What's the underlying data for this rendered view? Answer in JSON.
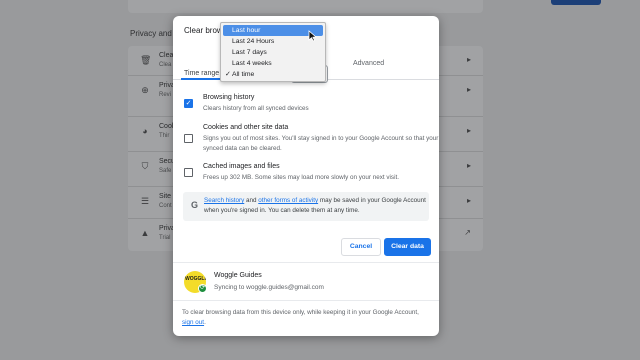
{
  "background": {
    "section_title": "Privacy and s",
    "rows": [
      {
        "icon": "trash-icon",
        "glyph": "🗑",
        "t1": "Clea",
        "t2": "Clea"
      },
      {
        "icon": "privacy-guide-icon",
        "glyph": "⊕",
        "t1": "Priva",
        "t2": "Revi"
      },
      {
        "icon": "cookie-icon",
        "glyph": "◕",
        "t1": "Cook",
        "t2": "Thir"
      },
      {
        "icon": "shield-icon",
        "glyph": "⛉",
        "t1": "Secu",
        "t2": "Safe"
      },
      {
        "icon": "sliders-icon",
        "glyph": "☰",
        "t1": "Site",
        "t2": "Cont"
      },
      {
        "icon": "flask-icon",
        "glyph": "▲",
        "t1": "Priva",
        "t2": "Trial"
      }
    ]
  },
  "dialog": {
    "title": "Clear brow",
    "tabs": {
      "basic": "",
      "advanced": "Advanced"
    },
    "time_range_label": "Time range",
    "options": [
      {
        "title": "Browsing history",
        "desc": "Clears history from all synced devices",
        "checked": true
      },
      {
        "title": "Cookies and other site data",
        "desc": "Signs you out of most sites. You'll stay signed in to your Google Account so that your synced data can be cleared.",
        "checked": false
      },
      {
        "title": "Cached images and files",
        "desc": "Frees up 302 MB. Some sites may load more slowly on your next visit.",
        "checked": false
      }
    ],
    "google_notice": {
      "link1": "Search history",
      "mid1": " and ",
      "link2": "other forms of activity",
      "rest": " may be saved in your Google Account when you're signed in. You can delete them at any time."
    },
    "buttons": {
      "cancel": "Cancel",
      "clear": "Clear data"
    },
    "account": {
      "name": "Woggle Guides",
      "sync": "Syncing to woggle.guides@gmail.com",
      "avatar_text": "WOGGLE"
    },
    "footer": {
      "text": "To clear browsing data from this device only, while keeping it in your Google Account, ",
      "link": "sign out",
      "end": "."
    }
  },
  "dropdown": {
    "items": [
      "Last hour",
      "Last 24 Hours",
      "Last 7 days",
      "Last 4 weeks",
      "All time"
    ],
    "highlighted": "Last hour",
    "selected": "All time",
    "check_glyph": "✓"
  },
  "colors": {
    "accent": "#1a73e8",
    "highlight": "#4c8fe7"
  }
}
